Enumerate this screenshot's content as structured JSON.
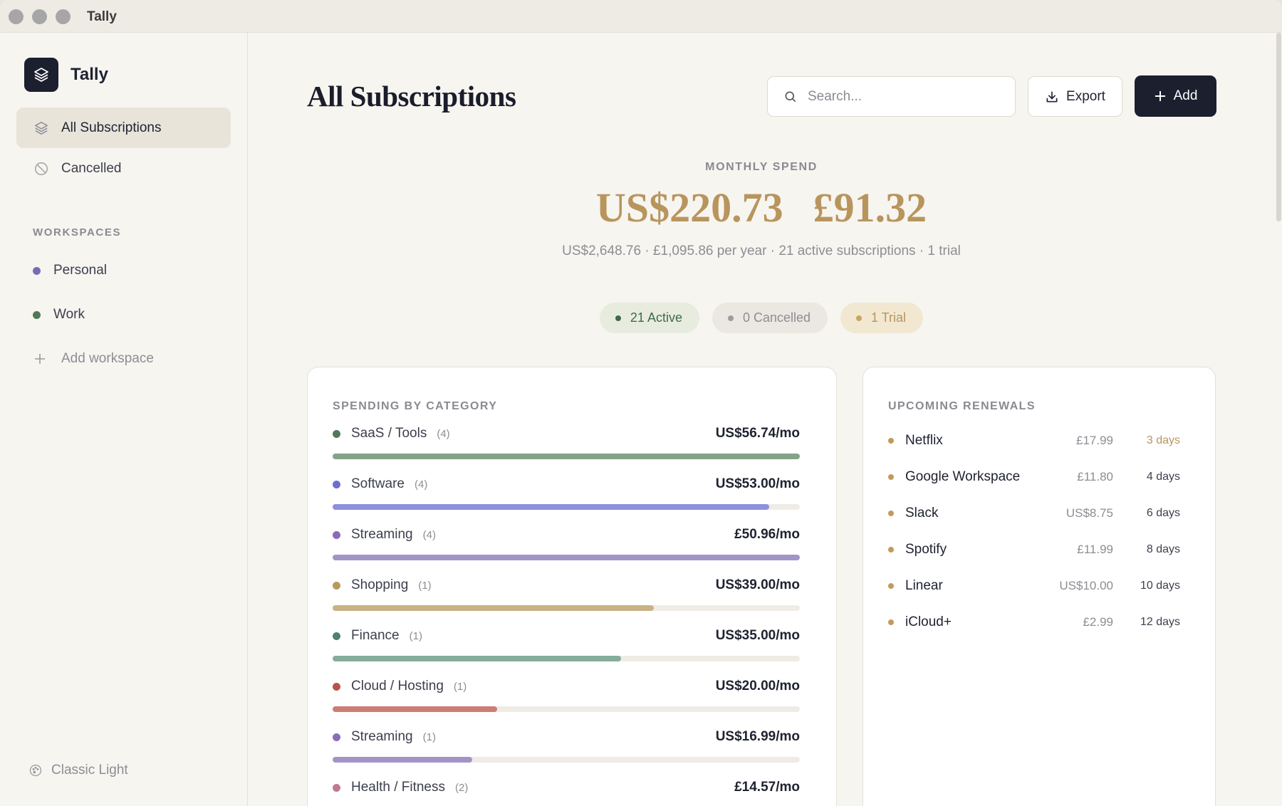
{
  "window": {
    "title": "Tally"
  },
  "sidebar": {
    "app_name": "Tally",
    "nav": [
      {
        "label": "All Subscriptions",
        "icon": "layers-icon",
        "active": true
      },
      {
        "label": "Cancelled",
        "icon": "cancel-circle-icon",
        "active": false
      }
    ],
    "workspaces_label": "WORKSPACES",
    "workspaces": [
      {
        "label": "Personal",
        "color": "#7b6bb0"
      },
      {
        "label": "Work",
        "color": "#4f7a5a"
      }
    ],
    "add_workspace_label": "Add workspace",
    "theme_label": "Classic Light"
  },
  "header": {
    "title": "All Subscriptions",
    "search_placeholder": "Search...",
    "export_label": "Export",
    "add_label": "Add"
  },
  "summary": {
    "label": "MONTHLY SPEND",
    "amount_usd": "US$220.73",
    "amount_gbp": "£91.32",
    "subtitle": "US$2,648.76 · £1,095.86 per year · 21 active subscriptions · 1 trial",
    "pills": {
      "active": "21 Active",
      "cancelled": "0 Cancelled",
      "trial": "1 Trial"
    }
  },
  "categories": {
    "title": "SPENDING BY CATEGORY",
    "items": [
      {
        "name": "SaaS / Tools",
        "count": "(4)",
        "amount": "US$56.74/mo",
        "fraction": 1.0,
        "dot": "#4f7a5a",
        "bar": "#83a488"
      },
      {
        "name": "Software",
        "count": "(4)",
        "amount": "US$53.00/mo",
        "fraction": 0.934,
        "dot": "#6b6fcf",
        "bar": "#8f8fdc"
      },
      {
        "name": "Streaming",
        "count": "(4)",
        "amount": "£50.96/mo",
        "fraction": 1.0,
        "dot": "#8a6bb8",
        "bar": "#a394c7"
      },
      {
        "name": "Shopping",
        "count": "(1)",
        "amount": "US$39.00/mo",
        "fraction": 0.687,
        "dot": "#b89a5e",
        "bar": "#c9b283"
      },
      {
        "name": "Finance",
        "count": "(1)",
        "amount": "US$35.00/mo",
        "fraction": 0.617,
        "dot": "#4f8070",
        "bar": "#84ad9b"
      },
      {
        "name": "Cloud / Hosting",
        "count": "(1)",
        "amount": "US$20.00/mo",
        "fraction": 0.352,
        "dot": "#b9534a",
        "bar": "#cc7d74"
      },
      {
        "name": "Streaming",
        "count": "(1)",
        "amount": "US$16.99/mo",
        "fraction": 0.299,
        "dot": "#8a6bb8",
        "bar": "#a394c7"
      },
      {
        "name": "Health / Fitness",
        "count": "(2)",
        "amount": "£14.57/mo",
        "fraction": 0.29,
        "dot": "#c07a8c",
        "bar": "#d19aa8"
      }
    ]
  },
  "renewals": {
    "title": "UPCOMING RENEWALS",
    "items": [
      {
        "name": "Netflix",
        "price": "£17.99",
        "days": "3 days",
        "soon": true
      },
      {
        "name": "Google Workspace",
        "price": "£11.80",
        "days": "4 days",
        "soon": false
      },
      {
        "name": "Slack",
        "price": "US$8.75",
        "days": "6 days",
        "soon": false
      },
      {
        "name": "Spotify",
        "price": "£11.99",
        "days": "8 days",
        "soon": false
      },
      {
        "name": "Linear",
        "price": "US$10.00",
        "days": "10 days",
        "soon": false
      },
      {
        "name": "iCloud+",
        "price": "£2.99",
        "days": "12 days",
        "soon": false
      }
    ]
  }
}
